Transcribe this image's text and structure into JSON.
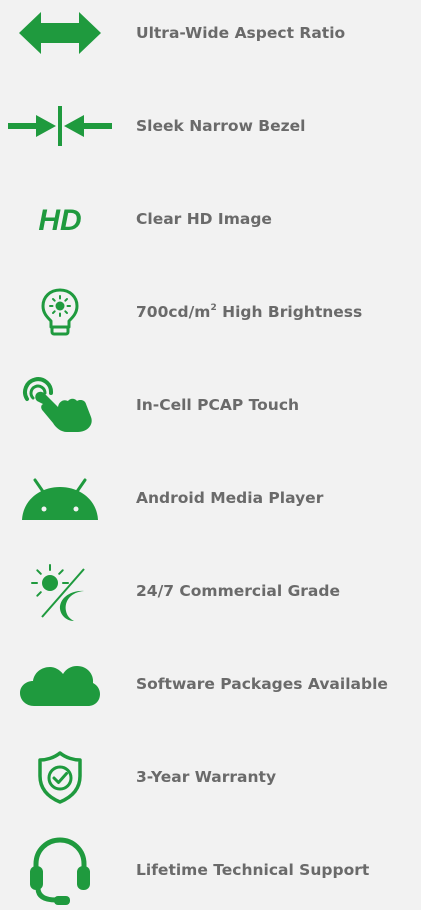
{
  "colors": {
    "accent": "#1f9a3e",
    "text": "#6a6a6a",
    "background": "#f2f2f2"
  },
  "features": [
    {
      "icon": "double-arrow-icon",
      "label": "Ultra-Wide Aspect Ratio"
    },
    {
      "icon": "narrow-bezel-icon",
      "label": "Sleek Narrow Bezel"
    },
    {
      "icon": "hd-icon",
      "icon_text": "HD",
      "label": "Clear HD Image"
    },
    {
      "icon": "lightbulb-icon",
      "label_prefix": "700cd/m",
      "label_sup": "2",
      "label_suffix": " High Brightness"
    },
    {
      "icon": "touch-hand-icon",
      "label": "In-Cell PCAP Touch"
    },
    {
      "icon": "android-icon",
      "label": "Android Media Player"
    },
    {
      "icon": "sun-moon-icon",
      "label": "24/7 Commercial Grade"
    },
    {
      "icon": "cloud-icon",
      "label": "Software Packages Available"
    },
    {
      "icon": "shield-check-icon",
      "label": "3-Year Warranty"
    },
    {
      "icon": "headset-icon",
      "label": "Lifetime Technical Support"
    }
  ]
}
